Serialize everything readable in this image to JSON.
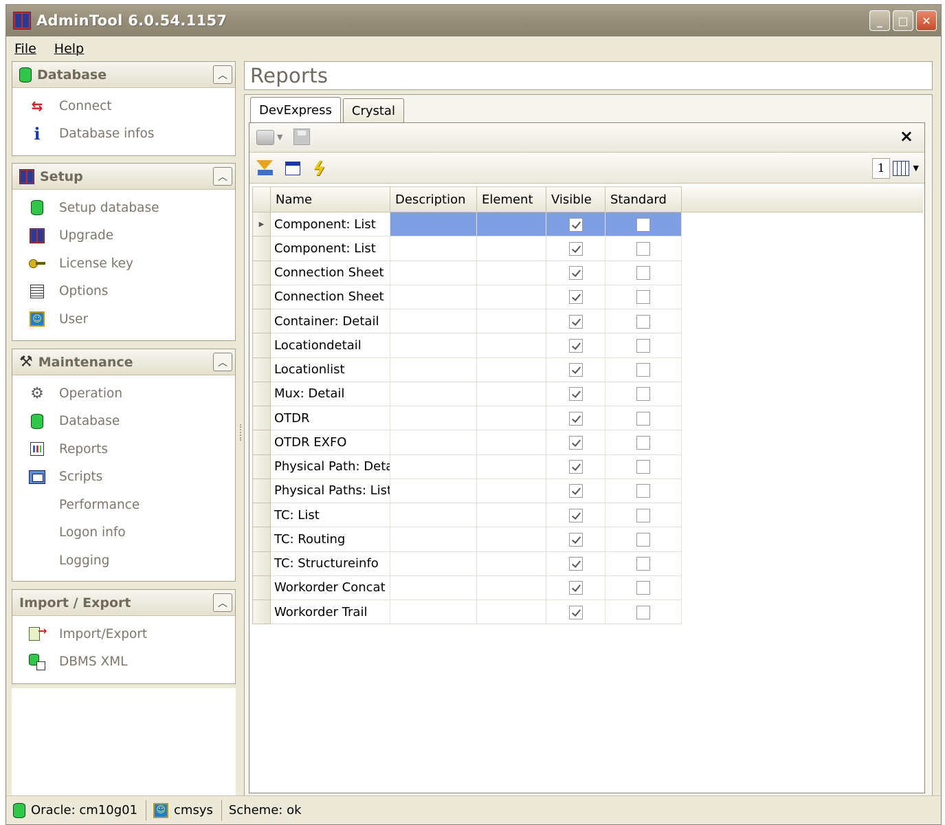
{
  "window": {
    "title": "AdminTool 6.0.54.1157",
    "controls": [
      "minimize",
      "maximize",
      "close"
    ]
  },
  "menubar": {
    "items": [
      "File",
      "Help"
    ]
  },
  "sidebar": {
    "groups": [
      {
        "title": "Database",
        "icon": "database-icon",
        "items": [
          {
            "label": "Connect",
            "icon": "connect-arrows-icon"
          },
          {
            "label": "Database infos",
            "icon": "info-icon"
          }
        ]
      },
      {
        "title": "Setup",
        "icon": "app-logo-icon",
        "items": [
          {
            "label": "Setup database",
            "icon": "database-icon"
          },
          {
            "label": "Upgrade",
            "icon": "app-logo-icon"
          },
          {
            "label": "License key",
            "icon": "key-icon"
          },
          {
            "label": "Options",
            "icon": "options-list-icon"
          },
          {
            "label": "User",
            "icon": "user-icon"
          }
        ]
      },
      {
        "title": "Maintenance",
        "icon": "tools-icon",
        "items": [
          {
            "label": "Operation",
            "icon": "gears-icon"
          },
          {
            "label": "Database",
            "icon": "database-icon"
          },
          {
            "label": "Reports",
            "icon": "report-icon"
          },
          {
            "label": "Scripts",
            "icon": "script-icon"
          },
          {
            "label": "Performance",
            "icon": ""
          },
          {
            "label": "Logon info",
            "icon": ""
          },
          {
            "label": "Logging",
            "icon": ""
          }
        ]
      },
      {
        "title": "Import / Export",
        "icon": "",
        "items": [
          {
            "label": "Import/Export",
            "icon": "import-export-icon"
          },
          {
            "label": "DBMS XML",
            "icon": "dbms-xml-icon"
          }
        ]
      }
    ]
  },
  "main": {
    "title": "Reports",
    "tabs": [
      {
        "label": "DevExpress",
        "active": true
      },
      {
        "label": "Crystal",
        "active": false
      }
    ],
    "toolbar": {
      "close_label": "×",
      "page_indicator": "1"
    },
    "grid": {
      "columns": [
        "Name",
        "Description",
        "Element",
        "Visible",
        "Standard"
      ],
      "rows": [
        {
          "name": "Component: List",
          "description": "",
          "element": "",
          "visible": true,
          "standard": false,
          "selected": true
        },
        {
          "name": "Component: List",
          "description": "",
          "element": "",
          "visible": true,
          "standard": false
        },
        {
          "name": "Connection Sheet",
          "description": "",
          "element": "",
          "visible": true,
          "standard": false
        },
        {
          "name": "Connection Sheet",
          "description": "",
          "element": "",
          "visible": true,
          "standard": false
        },
        {
          "name": "Container: Detail",
          "description": "",
          "element": "",
          "visible": true,
          "standard": false
        },
        {
          "name": "Locationdetail",
          "description": "",
          "element": "",
          "visible": true,
          "standard": false
        },
        {
          "name": "Locationlist",
          "description": "",
          "element": "",
          "visible": true,
          "standard": false
        },
        {
          "name": "Mux: Detail",
          "description": "",
          "element": "",
          "visible": true,
          "standard": false
        },
        {
          "name": "OTDR",
          "description": "",
          "element": "",
          "visible": true,
          "standard": false
        },
        {
          "name": "OTDR EXFO",
          "description": "",
          "element": "",
          "visible": true,
          "standard": false
        },
        {
          "name": "Physical Path: Detail",
          "description": "",
          "element": "",
          "visible": true,
          "standard": false
        },
        {
          "name": "Physical Paths: List",
          "description": "",
          "element": "",
          "visible": true,
          "standard": false
        },
        {
          "name": "TC: List",
          "description": "",
          "element": "",
          "visible": true,
          "standard": false
        },
        {
          "name": "TC: Routing",
          "description": "",
          "element": "",
          "visible": true,
          "standard": false
        },
        {
          "name": "TC: Structureinfo",
          "description": "",
          "element": "",
          "visible": true,
          "standard": false
        },
        {
          "name": "Workorder Concat",
          "description": "",
          "element": "",
          "visible": true,
          "standard": false
        },
        {
          "name": "Workorder Trail",
          "description": "",
          "element": "",
          "visible": true,
          "standard": false
        }
      ]
    }
  },
  "statusbar": {
    "connection": "Oracle: cm10g01",
    "user": "cmsys",
    "scheme": "Scheme: ok"
  },
  "colors": {
    "selection": "#7f9fe3",
    "chrome": "#ece9d8",
    "titlebar": "#958d78",
    "muted_text": "#7c776a"
  }
}
